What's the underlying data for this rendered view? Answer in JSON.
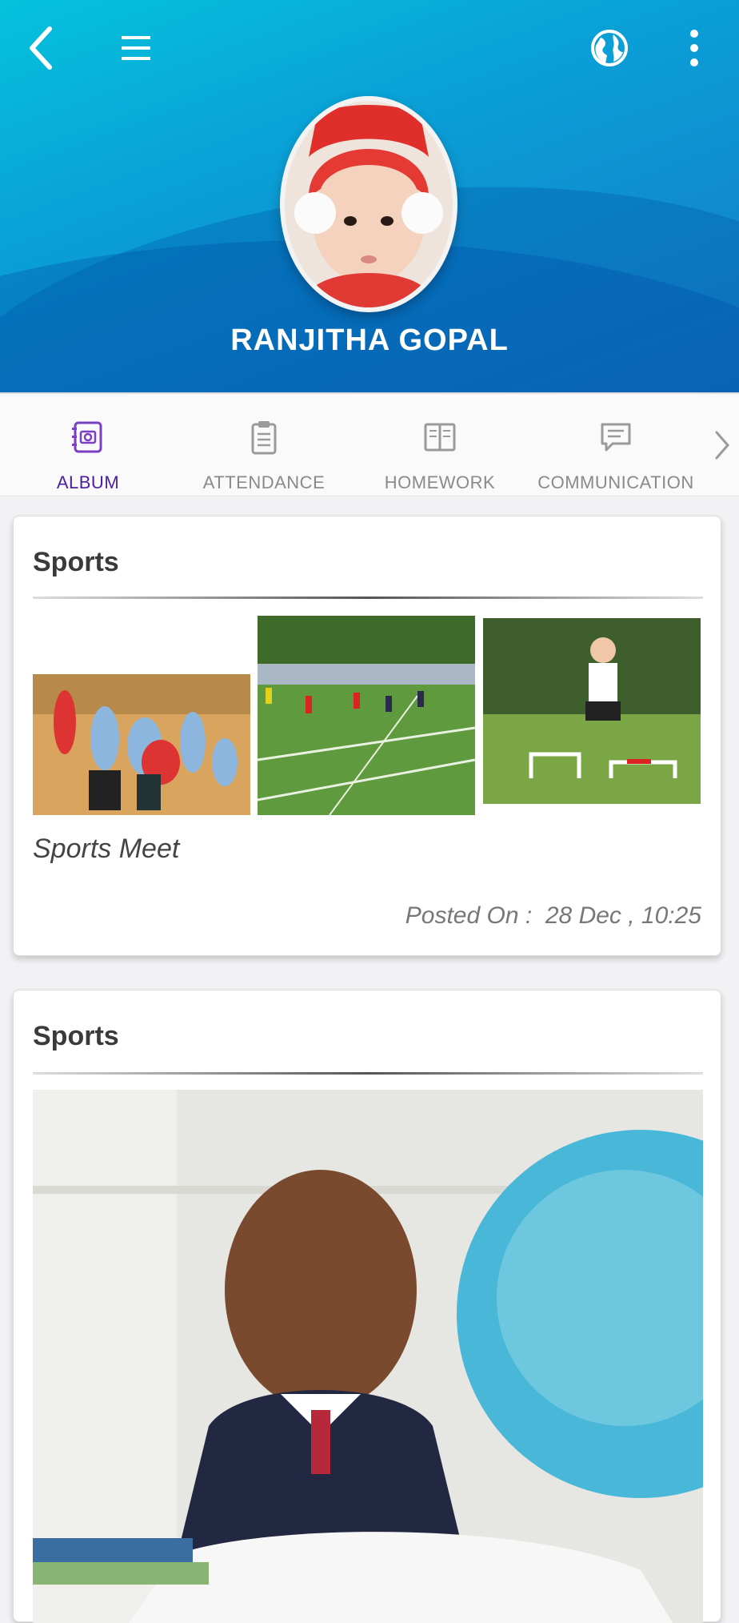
{
  "header": {
    "title": "RANJITHA GOPAL",
    "icons": [
      "back-icon",
      "hamburger-menu-icon",
      "globe-icon",
      "more-vertical-icon"
    ]
  },
  "tabs": [
    {
      "label": "ALBUM",
      "icon": "album-icon",
      "active": true
    },
    {
      "label": "ATTENDANCE",
      "icon": "clipboard-icon",
      "active": false
    },
    {
      "label": "HOMEWORK",
      "icon": "book-icon",
      "active": false
    },
    {
      "label": "COMMUNICATION",
      "icon": "chat-icon",
      "active": false
    }
  ],
  "posts": [
    {
      "title": "Sports",
      "caption": "Sports Meet",
      "posted_label": "Posted On :",
      "posted_value": "28 Dec , 10:25"
    },
    {
      "title": "Sports"
    }
  ],
  "colors": {
    "header_start": "#05c2dc",
    "header_end": "#1679c7",
    "active_tab": "#4b1fa0",
    "inactive_tab": "#8a8a8a"
  }
}
